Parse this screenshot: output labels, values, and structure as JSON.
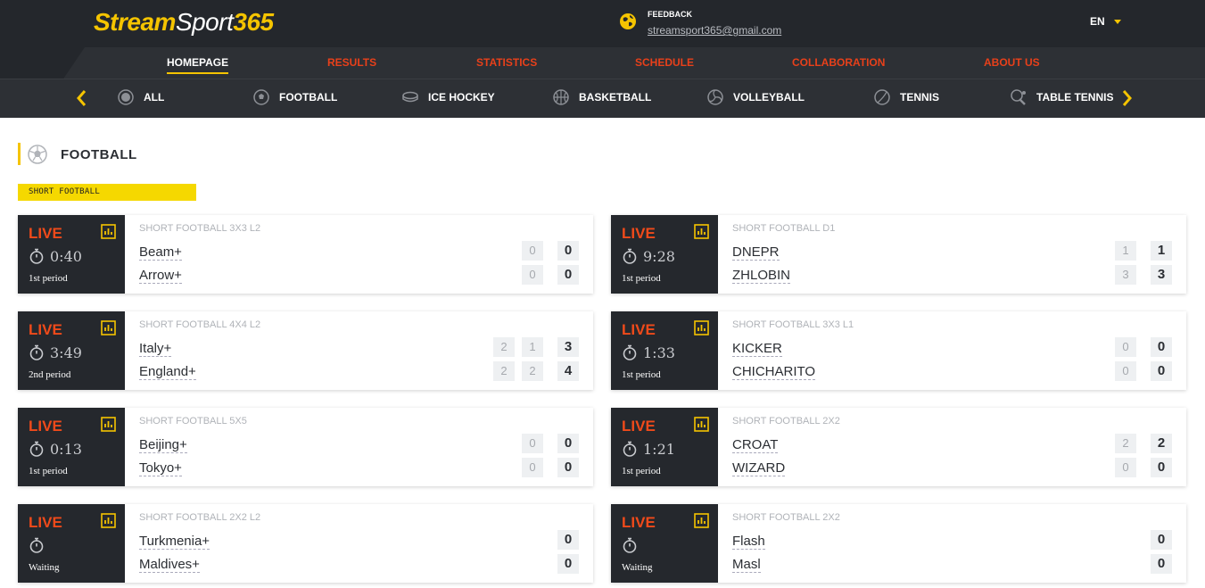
{
  "header": {
    "logo": {
      "part1": "Stream",
      "part2": "Sport",
      "part3": "365"
    },
    "feedback_label": "FEEDBACK",
    "feedback_email": "streamsport365@gmail.com",
    "language": "EN"
  },
  "nav": {
    "items": [
      "HOMEPAGE",
      "RESULTS",
      "STATISTICS",
      "SCHEDULE",
      "COLLABORATION",
      "ABOUT US"
    ],
    "active": "HOMEPAGE"
  },
  "sports": [
    {
      "label": "ALL",
      "icon": "all-icon"
    },
    {
      "label": "FOOTBALL",
      "icon": "football-icon"
    },
    {
      "label": "ICE HOCKEY",
      "icon": "hockey-puck-icon"
    },
    {
      "label": "BASKETBALL",
      "icon": "basketball-icon"
    },
    {
      "label": "VOLLEYBALL",
      "icon": "volleyball-icon"
    },
    {
      "label": "TENNIS",
      "icon": "tennis-ball-icon"
    },
    {
      "label": "TABLE TENNIS",
      "icon": "table-tennis-icon"
    }
  ],
  "section": {
    "title": "FOOTBALL",
    "league_badge": "SHORT FOOTBALL"
  },
  "colors": {
    "accent": "#f5c400",
    "live": "#f04a1a",
    "nav_link": "#e8401a",
    "dark": "#24272c"
  },
  "matches": [
    {
      "status": "LIVE",
      "time": "0:40",
      "period": "1st period",
      "league": "SHORT FOOTBALL 3X3 L2",
      "team1": "Beam+",
      "team2": "Arrow+",
      "sub1": [
        "0"
      ],
      "sub2": [
        "0"
      ],
      "score1": "0",
      "score2": "0"
    },
    {
      "status": "LIVE",
      "time": "9:28",
      "period": "1st period",
      "league": "SHORT FOOTBALL D1",
      "team1": "DNEPR",
      "team2": "ZHLOBIN",
      "sub1": [
        "1"
      ],
      "sub2": [
        "3"
      ],
      "score1": "1",
      "score2": "3"
    },
    {
      "status": "LIVE",
      "time": "3:49",
      "period": "2nd period",
      "league": "SHORT FOOTBALL 4X4 L2",
      "team1": "Italy+",
      "team2": "England+",
      "sub1": [
        "2",
        "1"
      ],
      "sub2": [
        "2",
        "2"
      ],
      "score1": "3",
      "score2": "4"
    },
    {
      "status": "LIVE",
      "time": "1:33",
      "period": "1st period",
      "league": "SHORT FOOTBALL 3X3 L1",
      "team1": "KICKER",
      "team2": "CHICHARITO",
      "sub1": [
        "0"
      ],
      "sub2": [
        "0"
      ],
      "score1": "0",
      "score2": "0"
    },
    {
      "status": "LIVE",
      "time": "0:13",
      "period": "1st period",
      "league": "SHORT FOOTBALL 5X5",
      "team1": "Beijing+",
      "team2": "Tokyo+",
      "sub1": [
        "0"
      ],
      "sub2": [
        "0"
      ],
      "score1": "0",
      "score2": "0"
    },
    {
      "status": "LIVE",
      "time": "1:21",
      "period": "1st period",
      "league": "SHORT FOOTBALL 2X2",
      "team1": "CROAT",
      "team2": "WIZARD",
      "sub1": [
        "2"
      ],
      "sub2": [
        "0"
      ],
      "score1": "2",
      "score2": "0"
    },
    {
      "status": "LIVE",
      "time": "",
      "period": "Waiting",
      "league": "SHORT FOOTBALL 2X2 L2",
      "team1": "Turkmenia+",
      "team2": "Maldives+",
      "sub1": [],
      "sub2": [],
      "score1": "0",
      "score2": "0"
    },
    {
      "status": "LIVE",
      "time": "",
      "period": "Waiting",
      "league": "SHORT FOOTBALL 2X2",
      "team1": "Flash",
      "team2": "Masl",
      "sub1": [],
      "sub2": [],
      "score1": "0",
      "score2": "0"
    }
  ]
}
